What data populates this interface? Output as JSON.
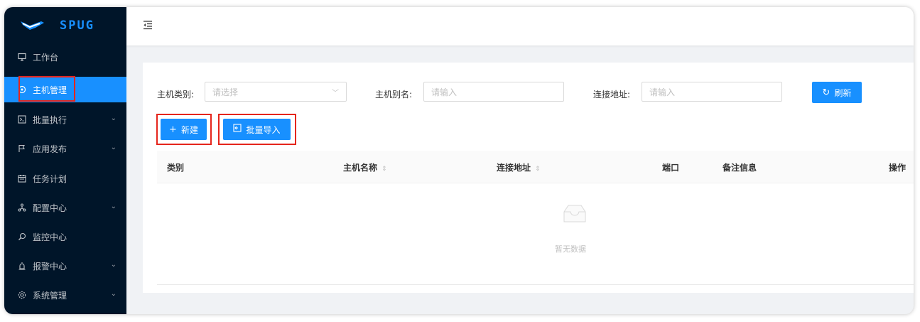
{
  "sidebar": {
    "logo_text": "SPUG",
    "items": [
      {
        "label": "工作台",
        "icon": "desktop-icon",
        "has_children": false
      },
      {
        "label": "主机管理",
        "icon": "cloud-server-icon",
        "has_children": false,
        "active": true
      },
      {
        "label": "批量执行",
        "icon": "code-icon",
        "has_children": true
      },
      {
        "label": "应用发布",
        "icon": "flag-icon",
        "has_children": true
      },
      {
        "label": "任务计划",
        "icon": "schedule-icon",
        "has_children": false
      },
      {
        "label": "配置中心",
        "icon": "deployment-unit-icon",
        "has_children": true
      },
      {
        "label": "监控中心",
        "icon": "monitor-icon",
        "has_children": false
      },
      {
        "label": "报警中心",
        "icon": "alert-icon",
        "has_children": true
      },
      {
        "label": "系统管理",
        "icon": "setting-icon",
        "has_children": true
      }
    ]
  },
  "header": {
    "fold_icon": "menu-fold-icon"
  },
  "filters": {
    "category_label": "主机类别:",
    "category_placeholder": "请选择",
    "alias_label": "主机别名:",
    "alias_placeholder": "请输入",
    "address_label": "连接地址:",
    "address_placeholder": "请输入",
    "refresh_label": "刷新"
  },
  "actions": {
    "new_label": "新建",
    "import_label": "批量导入"
  },
  "table": {
    "columns": [
      "类别",
      "主机名称",
      "连接地址",
      "端口",
      "备注信息",
      "操作"
    ],
    "empty_text": "暂无数据"
  },
  "colors": {
    "primary": "#1890ff",
    "sidebar": "#001529",
    "highlight": "#e5251c"
  }
}
